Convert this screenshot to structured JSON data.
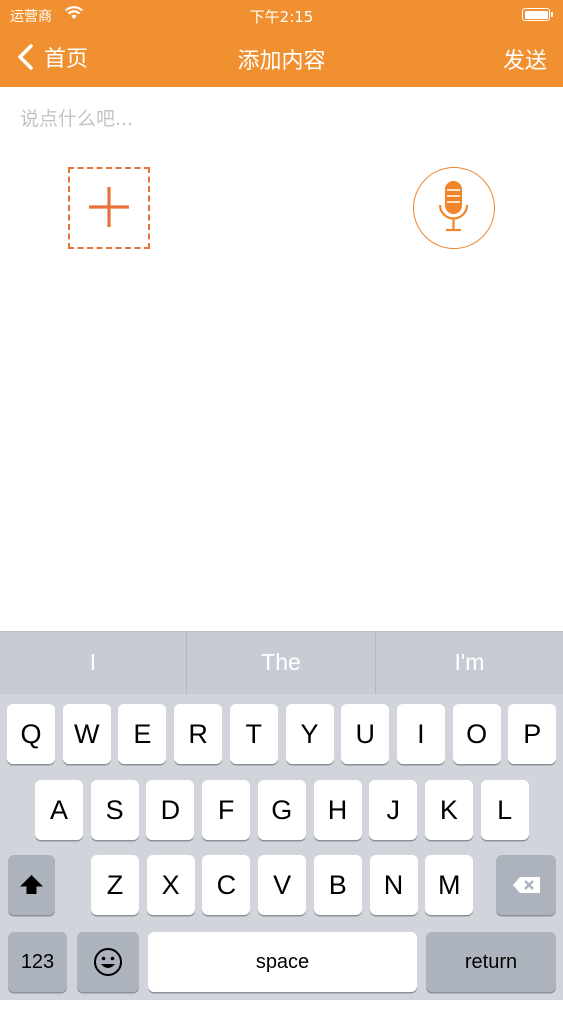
{
  "status_bar": {
    "carrier": "运营商",
    "time": "下午2:15",
    "battery_level": 1.0
  },
  "nav": {
    "back_label": "首页",
    "title": "添加内容",
    "send_label": "发送"
  },
  "compose": {
    "placeholder": "说点什么吧...",
    "value": ""
  },
  "icons": {
    "add": "plus-icon",
    "mic": "microphone-icon",
    "back": "chevron-left-icon",
    "wifi": "wifi-icon",
    "battery": "battery-icon",
    "shift": "shift-icon",
    "delete": "backspace-icon",
    "emoji": "emoji-icon"
  },
  "colors": {
    "accent": "#f19030",
    "icon_orange": "#e8733a"
  },
  "keyboard": {
    "suggestions": [
      "I",
      "The",
      "I'm"
    ],
    "row1": [
      "Q",
      "W",
      "E",
      "R",
      "T",
      "Y",
      "U",
      "I",
      "O",
      "P"
    ],
    "row2": [
      "A",
      "S",
      "D",
      "F",
      "G",
      "H",
      "J",
      "K",
      "L"
    ],
    "row3": [
      "Z",
      "X",
      "C",
      "V",
      "B",
      "N",
      "M"
    ],
    "numbers_label": "123",
    "space_label": "space",
    "return_label": "return"
  }
}
